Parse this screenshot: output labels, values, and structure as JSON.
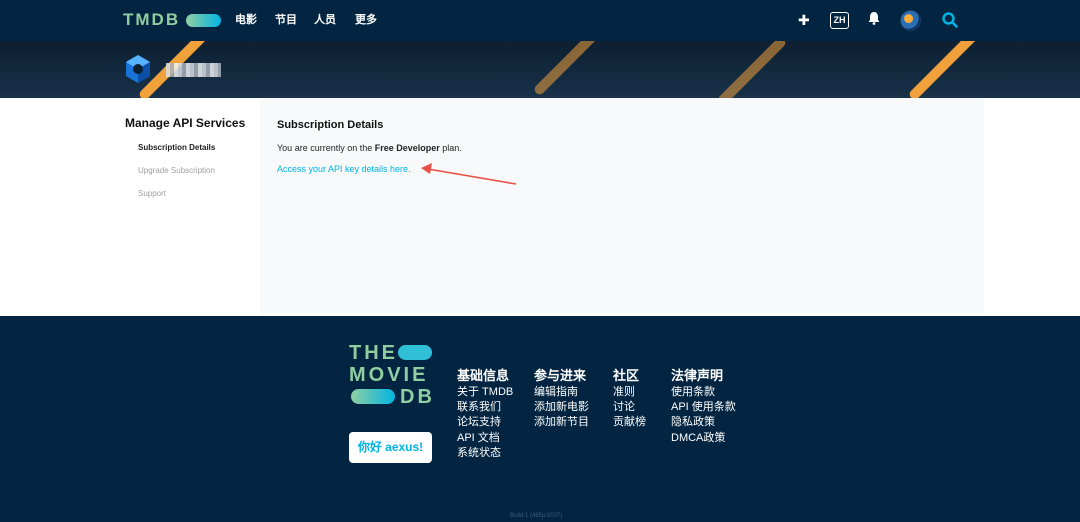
{
  "colors": {
    "navy": "#032541",
    "green": "#90cea1",
    "blue": "#01b4e4",
    "orange": "#f0a13a",
    "arrow": "#e8504a"
  },
  "nav": {
    "logo": "TMDB",
    "links": [
      "电影",
      "节目",
      "人员",
      "更多"
    ],
    "icons": {
      "add": "plus-icon",
      "lang": "ZH",
      "notifications": "bell-icon",
      "search": "search-icon"
    }
  },
  "sidebar": {
    "title": "Manage API Services",
    "items": [
      {
        "label": "Subscription Details",
        "active": true
      },
      {
        "label": "Upgrade Subscription",
        "active": false
      },
      {
        "label": "Support",
        "active": false
      }
    ]
  },
  "content": {
    "title": "Subscription Details",
    "plan_prefix": "You are currently on the ",
    "plan_name": "Free Developer",
    "plan_suffix": " plan.",
    "api_link": "Access your API key details here."
  },
  "footer": {
    "logo_lines": [
      "THE",
      "MOVIE",
      "DB"
    ],
    "hello_button": "你好 aexus!",
    "columns": [
      {
        "title": "基础信息",
        "items": [
          "关于 TMDB",
          "联系我们",
          "论坛支持",
          "API 文档",
          "系统状态"
        ]
      },
      {
        "title": "参与进来",
        "items": [
          "编辑指南",
          "添加新电影",
          "添加新节目"
        ]
      },
      {
        "title": "社区",
        "items": [
          "准则",
          "讨论",
          "贡献榜"
        ]
      },
      {
        "title": "法律声明",
        "items": [
          "使用条款",
          "API 使用条款",
          "隐私政策",
          "DMCA政策"
        ]
      }
    ],
    "build": "Build 1 (485p:0037)"
  }
}
